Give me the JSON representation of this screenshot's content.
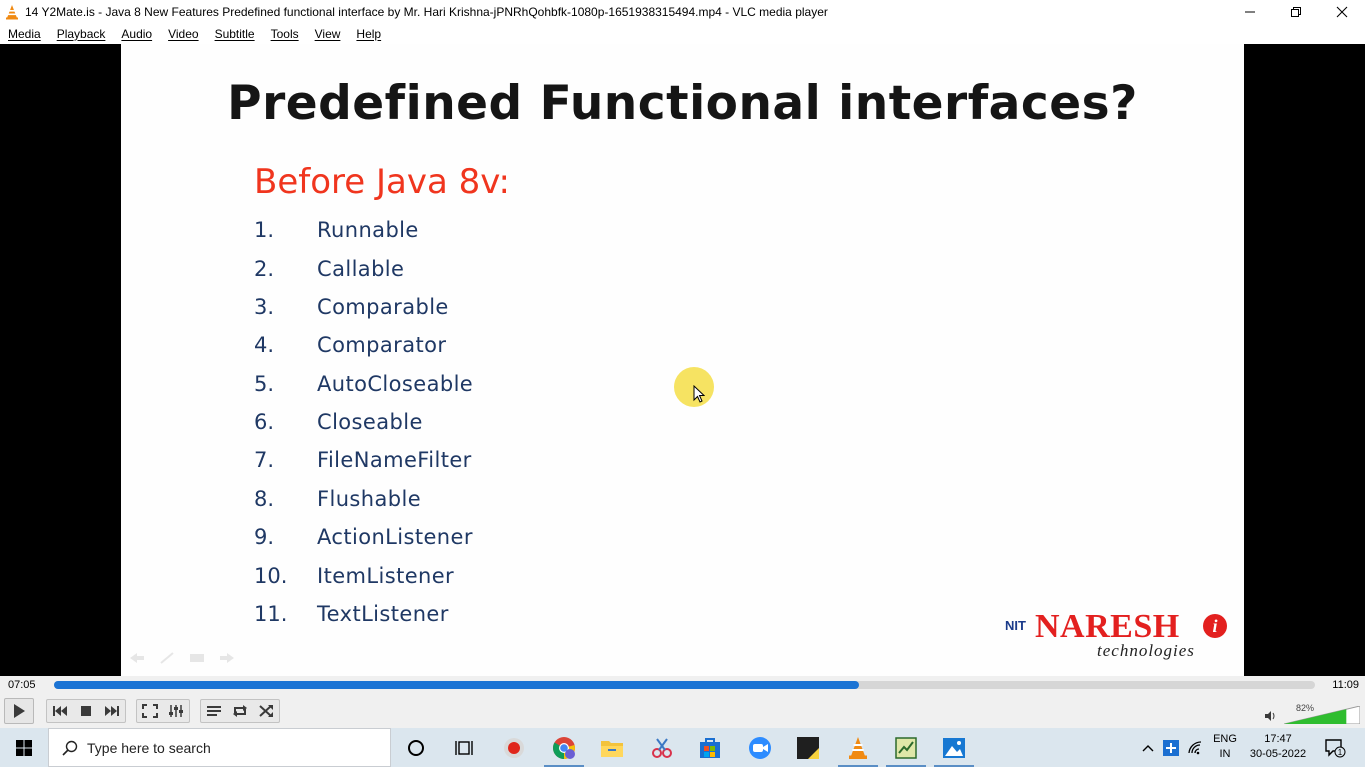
{
  "window": {
    "title": "14 Y2Mate.is - Java 8 New Features  Predefined functional interface  by Mr. Hari Krishna-jPNRhQohbfk-1080p-1651938315494.mp4 - VLC media player"
  },
  "menu": [
    {
      "label": "Media"
    },
    {
      "label": "Playback"
    },
    {
      "label": "Audio"
    },
    {
      "label": "Video"
    },
    {
      "label": "Subtitle"
    },
    {
      "label": "Tools"
    },
    {
      "label": "View"
    },
    {
      "label": "Help"
    }
  ],
  "slide": {
    "title": "Predefined Functional interfaces?",
    "subtitle": "Before Java 8v:",
    "items": [
      {
        "num": "1.",
        "label": "Runnable"
      },
      {
        "num": "2.",
        "label": "Callable"
      },
      {
        "num": "3.",
        "label": "Comparable"
      },
      {
        "num": "4.",
        "label": "Comparator"
      },
      {
        "num": "5.",
        "label": "AutoCloseable"
      },
      {
        "num": "6.",
        "label": "Closeable"
      },
      {
        "num": "7.",
        "label": "FileNameFilter"
      },
      {
        "num": "8.",
        "label": "Flushable"
      },
      {
        "num": "9.",
        "label": "ActionListener"
      },
      {
        "num": "10.",
        "label": "ItemListener"
      },
      {
        "num": "11.",
        "label": "TextListener"
      }
    ],
    "logo": {
      "name": "NARESH",
      "tagline": "technologies",
      "mark": "NIT",
      "i_letter": "i"
    },
    "colors": {
      "title": "#151515",
      "subtitle": "#f0351e",
      "items": "#1f3864"
    }
  },
  "player": {
    "elapsed": "07:05",
    "total": "11:09",
    "progress_fraction": 0.638,
    "volume_percent_label": "82%",
    "volume_fraction": 0.82,
    "accent_color": "#1c74d4"
  },
  "taskbar": {
    "search_placeholder": "Type here to search",
    "language_line1": "ENG",
    "language_line2": "IN",
    "time": "17:47",
    "date": "30-05-2022",
    "notification_count": "1"
  }
}
